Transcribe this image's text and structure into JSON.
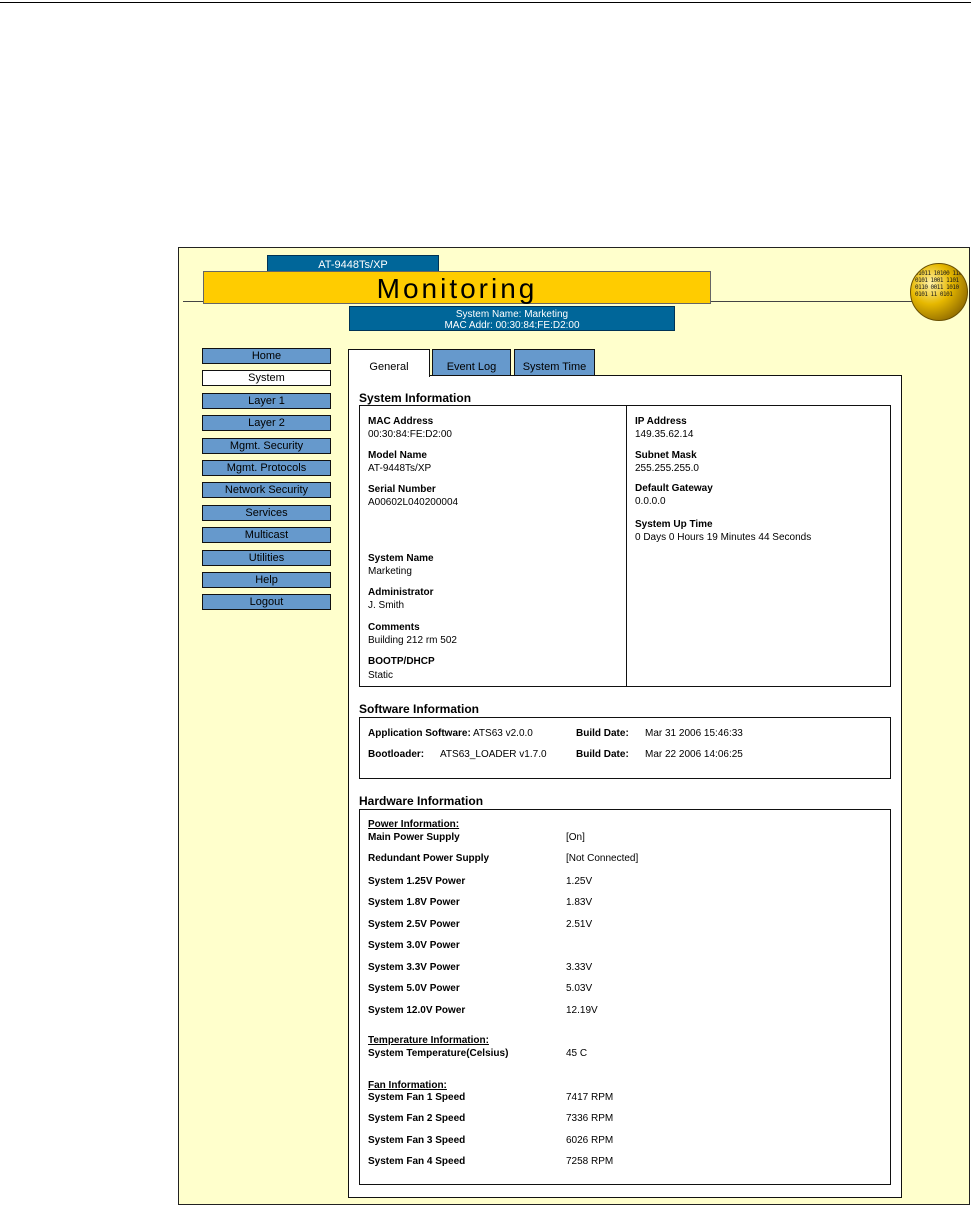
{
  "header": {
    "model": "AT-9448Ts/XP",
    "title": "Monitoring",
    "system_name_line": "System Name: Marketing",
    "mac_line": "MAC Addr: 00:30:84:FE:D2:00",
    "globe_bits": "01011 10100 110 0101 1001 1101 0110 0011 1010 0101 11 0101"
  },
  "nav": {
    "items": [
      "Home",
      "System",
      "Layer 1",
      "Layer 2",
      "Mgmt. Security",
      "Mgmt. Protocols",
      "Network Security",
      "Services",
      "Multicast",
      "Utilities",
      "Help",
      "Logout"
    ],
    "active": "System"
  },
  "tabs": [
    "General",
    "Event Log",
    "System Time"
  ],
  "system_info": {
    "title": "System Information",
    "mac_label": "MAC Address",
    "mac_value": "00:30:84:FE:D2:00",
    "model_label": "Model Name",
    "model_value": "AT-9448Ts/XP",
    "serial_label": "Serial Number",
    "serial_value": "A00602L040200004",
    "sysname_label": "System Name",
    "sysname_value": "Marketing",
    "admin_label": "Administrator",
    "admin_value": "J. Smith",
    "comments_label": "Comments",
    "comments_value": "Building 212 rm 502",
    "bootp_label": "BOOTP/DHCP",
    "bootp_value": "Static",
    "ip_label": "IP Address",
    "ip_value": "149.35.62.14",
    "subnet_label": "Subnet Mask",
    "subnet_value": "255.255.255.0",
    "gateway_label": "Default Gateway",
    "gateway_value": "0.0.0.0",
    "uptime_label": "System Up Time",
    "uptime_value": "0 Days 0 Hours 19 Minutes 44 Seconds"
  },
  "software_info": {
    "title": "Software Information",
    "app_label": "Application Software:",
    "app_value": "ATS63 v2.0.0",
    "app_build_label": "Build Date:",
    "app_build_value": "Mar 31 2006 15:46:33",
    "boot_label": "Bootloader:",
    "boot_value": "ATS63_LOADER v1.7.0",
    "boot_build_label": "Build Date:",
    "boot_build_value": "Mar 22 2006 14:06:25"
  },
  "hardware_info": {
    "title": "Hardware Information",
    "power_heading": "Power Information:",
    "power_rows": [
      {
        "label": "Main Power Supply",
        "value": "[On]"
      },
      {
        "label": "Redundant Power Supply",
        "value": "[Not Connected]"
      },
      {
        "label": "System 1.25V Power",
        "value": "1.25V"
      },
      {
        "label": "System 1.8V Power",
        "value": "1.83V"
      },
      {
        "label": "System 2.5V Power",
        "value": "2.51V"
      },
      {
        "label": "System 3.0V Power",
        "value": ""
      },
      {
        "label": "System 3.3V Power",
        "value": "3.33V"
      },
      {
        "label": "System 5.0V Power",
        "value": "5.03V"
      },
      {
        "label": "System 12.0V Power",
        "value": "12.19V"
      }
    ],
    "temp_heading": "Temperature Information:",
    "temp_label": "System Temperature(Celsius)",
    "temp_value": "45 C",
    "fan_heading": "Fan Information:",
    "fan_rows": [
      {
        "label": "System Fan 1 Speed",
        "value": "7417 RPM"
      },
      {
        "label": "System Fan 2 Speed",
        "value": "7336 RPM"
      },
      {
        "label": "System Fan 3 Speed",
        "value": "6026 RPM"
      },
      {
        "label": "System Fan 4 Speed",
        "value": "7258 RPM"
      }
    ]
  }
}
